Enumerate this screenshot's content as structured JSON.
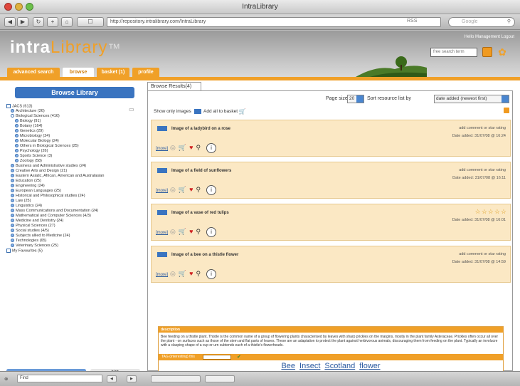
{
  "window": {
    "title": "IntraLibrary"
  },
  "browser": {
    "url": "http://repository.intralibrary.com/IntraLibrary",
    "rss": "RSS",
    "search_placeholder": "Google",
    "status_search": "Find"
  },
  "header": {
    "logo_intra": "intra",
    "logo_library": "Library",
    "logo_mark": "™",
    "user_links": "Hello Management Logout",
    "quick_search": "free search term"
  },
  "tabs": [
    {
      "label": "advanced search"
    },
    {
      "label": "browse"
    },
    {
      "label": "basket (1)"
    },
    {
      "label": "profile"
    }
  ],
  "sidebar": {
    "browse_label": "Browse Library",
    "root": "JACS (613)",
    "items": [
      {
        "label": "Architecture (26)",
        "indent": 1,
        "open": false
      },
      {
        "label": "Biological Sciences (416)",
        "indent": 1,
        "open": true
      },
      {
        "label": "Biology (91)",
        "indent": 2,
        "open": false
      },
      {
        "label": "Botany (164)",
        "indent": 2,
        "open": false
      },
      {
        "label": "Genetics (29)",
        "indent": 2,
        "open": false
      },
      {
        "label": "Microbiology (24)",
        "indent": 2,
        "open": false
      },
      {
        "label": "Molecular Biology (24)",
        "indent": 2,
        "open": false
      },
      {
        "label": "Others in Biological Sciences (25)",
        "indent": 2,
        "open": false
      },
      {
        "label": "Psychology (26)",
        "indent": 2,
        "open": false
      },
      {
        "label": "Sports Science (3)",
        "indent": 2,
        "open": false
      },
      {
        "label": "Zoology (58)",
        "indent": 2,
        "open": false
      },
      {
        "label": "Business and Administrative studies (24)",
        "indent": 1,
        "open": false
      },
      {
        "label": "Creative Arts and Design (21)",
        "indent": 1,
        "open": false
      },
      {
        "label": "Eastern Asiatic, African, American and Australasian",
        "indent": 1,
        "open": false
      },
      {
        "label": "Education (25)",
        "indent": 1,
        "open": false
      },
      {
        "label": "Engineering (24)",
        "indent": 1,
        "open": false
      },
      {
        "label": "European Languages (25)",
        "indent": 1,
        "open": false
      },
      {
        "label": "Historical and Philosophical studies (24)",
        "indent": 1,
        "open": false
      },
      {
        "label": "Law (25)",
        "indent": 1,
        "open": false
      },
      {
        "label": "Linguistics (24)",
        "indent": 1,
        "open": false
      },
      {
        "label": "Mass Communications and Documentation (24)",
        "indent": 1,
        "open": false
      },
      {
        "label": "Mathematical and Computer Sciences (4/3)",
        "indent": 1,
        "open": false
      },
      {
        "label": "Medicine and Dentistry (24)",
        "indent": 1,
        "open": false
      },
      {
        "label": "Physical Sciences (27)",
        "indent": 1,
        "open": false
      },
      {
        "label": "Social studies (4/5)",
        "indent": 1,
        "open": false
      },
      {
        "label": "Subjects allied to Medicine (24)",
        "indent": 1,
        "open": false
      },
      {
        "label": "Technologies (65)",
        "indent": 1,
        "open": false
      },
      {
        "label": "Veterinary Sciences (25)",
        "indent": 1,
        "open": false
      }
    ],
    "favourites": "My Favourites (5)",
    "scroll_label": "▶ ▶▶"
  },
  "content": {
    "tab_label": "Browse Results(4)",
    "page_size_label": "Page size",
    "page_size_value": "20",
    "sort_label": "Sort resource list by",
    "sort_value": "date added (newest first)",
    "show_only": "Show only images",
    "add_all": "Add all to basket"
  },
  "results": [
    {
      "title": "Image of a ladybird on a rose",
      "rating": "add comment or star rating",
      "date": "Date added: 31/07/08 @ 16:24",
      "stars": ""
    },
    {
      "title": "Image of a field of sunflowers",
      "rating": "add comment or star rating",
      "date": "Date added: 31/07/08 @ 16:11",
      "stars": ""
    },
    {
      "title": "Image of a vase of red tulips",
      "rating": "",
      "date": "Date added: 31/07/08 @ 16:01",
      "stars": "☆☆☆☆☆"
    },
    {
      "title": "Image of a bee on a thistle flower",
      "rating": "add comment or star rating",
      "date": "Date added: 31/07/08 @ 14:59",
      "stars": ""
    }
  ],
  "result_action_label": "[more]",
  "description": {
    "heading": "description",
    "text": "Bee feeding on a thistle plant. Thistle is the common name of a group of flowering plants characterised by leaves with sharp prickles on the margins, mostly in the plant family Asteraceae. Prickles often occur all over the plant - on surfaces such as those of the stem and flat parts of leaves. These are an adaptation to protect the plant against herbivorous animals, discouraging them from feeding on the plant. Typically an involucre with a clasping shape of a cup or urn subtends each of a thistle's flowerheads.",
    "tag_label": "TAG (interesting) this",
    "tags": [
      "Bee",
      "Insect",
      "Scotland",
      "flower"
    ]
  },
  "colors": {
    "accent": "#f0a028",
    "primary": "#3a74c0",
    "card_bg": "#fbe8c4"
  }
}
